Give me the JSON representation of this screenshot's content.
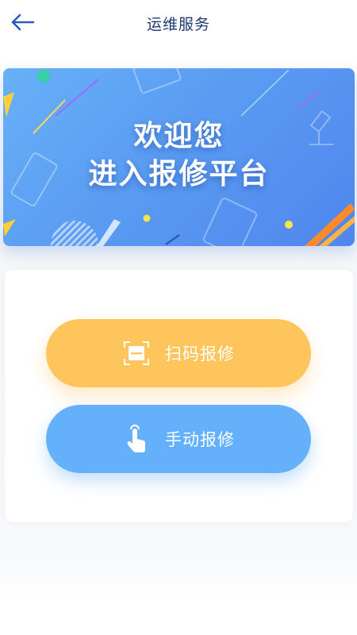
{
  "header": {
    "title": "运维服务",
    "back_icon": "arrow-left-icon"
  },
  "banner": {
    "line1": "欢迎您",
    "line2": "进入报修平台"
  },
  "actions": {
    "scan": {
      "label": "扫码报修",
      "icon": "scan-icon",
      "color": "#fdc55c"
    },
    "manual": {
      "label": "手动报修",
      "icon": "hand-tap-icon",
      "color": "#64b0fb"
    }
  },
  "colors": {
    "title": "#1e3a6e",
    "banner_start": "#67b1f7",
    "banner_end": "#4f86ee"
  }
}
